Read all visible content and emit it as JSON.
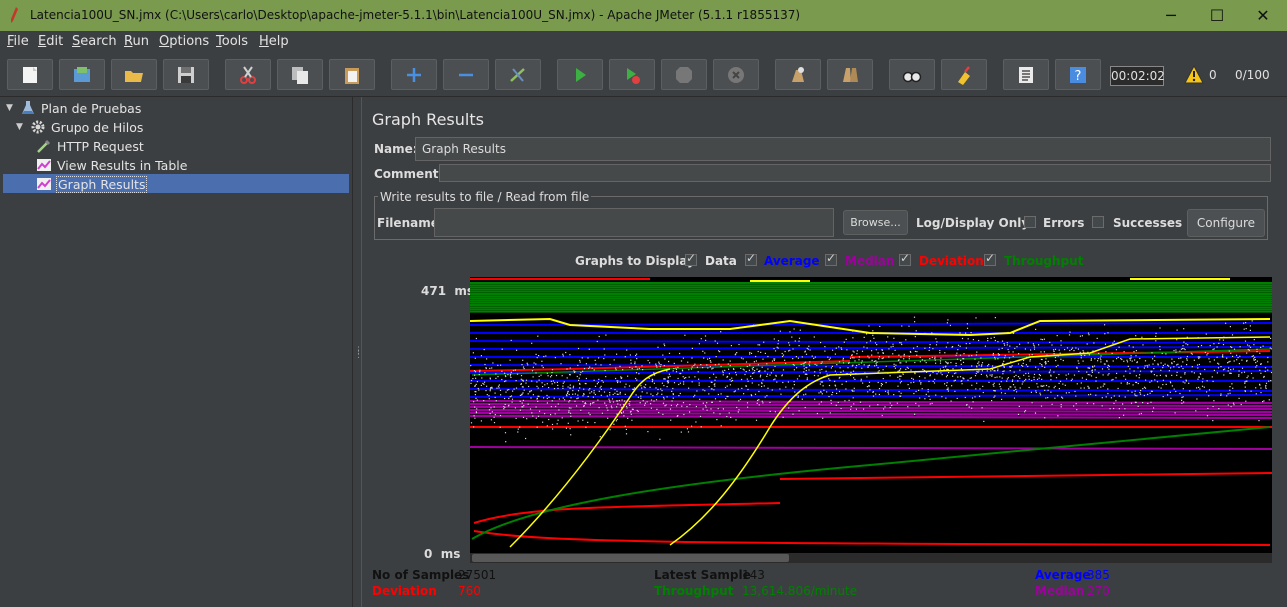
{
  "window": {
    "title": "Latencia100U_SN.jmx (C:\\Users\\carlo\\Desktop\\apache-jmeter-5.1.1\\bin\\Latencia100U_SN.jmx) - Apache JMeter (5.1.1 r1855137)",
    "minimize": "─",
    "maximize": "☐",
    "close": "✕"
  },
  "menu": [
    "File",
    "Edit",
    "Search",
    "Run",
    "Options",
    "Tools",
    "Help"
  ],
  "toolbar": {
    "timer": "00:02:02",
    "warnings": "0",
    "threads": "0/100",
    "icons": [
      "new-icon",
      "templates-icon",
      "open-icon",
      "save-icon",
      "cut-icon",
      "copy-icon",
      "paste-icon",
      "expand-icon",
      "collapse-icon",
      "toggle-icon",
      "start-icon",
      "start-no-pauses-icon",
      "stop-icon",
      "shutdown-icon",
      "clear-icon",
      "clear-all-icon",
      "search-icon",
      "reset-search-icon",
      "function-helper-icon",
      "help-icon"
    ]
  },
  "tree": {
    "items": [
      {
        "label": "Plan de Pruebas"
      },
      {
        "label": "Grupo de Hilos"
      },
      {
        "label": "HTTP Request"
      },
      {
        "label": "View Results in Table"
      },
      {
        "label": "Graph Results"
      }
    ]
  },
  "panel": {
    "heading": "Graph Results",
    "name_label": "Name:",
    "name_value": "Graph Results",
    "comments_label": "Comments:",
    "write_results_legend": "Write results to file / Read from file",
    "filename_label": "Filename",
    "filename_value": "",
    "browse_label": "Browse...",
    "log_display_only": "Log/Display Only:",
    "errors_label": "Errors",
    "successes_label": "Successes",
    "configure_label": "Configure",
    "graphs_to_display": "Graphs to Display",
    "toggles": [
      {
        "label": "Data",
        "color": "#e0e0e0",
        "checked": true
      },
      {
        "label": "Average",
        "color": "#0000ff",
        "checked": true
      },
      {
        "label": "Median",
        "color": "#a000a0",
        "checked": true
      },
      {
        "label": "Deviation",
        "color": "#ff0000",
        "checked": true
      },
      {
        "label": "Throughput",
        "color": "#008000",
        "checked": true
      }
    ]
  },
  "chart_data": {
    "type": "line",
    "y_max_label": "471",
    "y_min_label": "0",
    "y_unit": "ms",
    "ylim": [
      0,
      471
    ],
    "series": [
      {
        "name": "Data",
        "color": "#ffffff"
      },
      {
        "name": "Average",
        "color": "#0000ff"
      },
      {
        "name": "Median",
        "color": "#a000a0"
      },
      {
        "name": "Deviation",
        "color": "#ff0000"
      },
      {
        "name": "Throughput",
        "color": "#008000"
      }
    ]
  },
  "stats": {
    "no_of_samples_label": "No of Samples",
    "no_of_samples": "27501",
    "latest_sample_label": "Latest Sample",
    "latest_sample": "143",
    "average_label": "Average",
    "average": "385",
    "deviation_label": "Deviation",
    "deviation": "760",
    "throughput_label": "Throughput",
    "throughput": "13,614.806/minute",
    "median_label": "Median",
    "median": "270"
  }
}
